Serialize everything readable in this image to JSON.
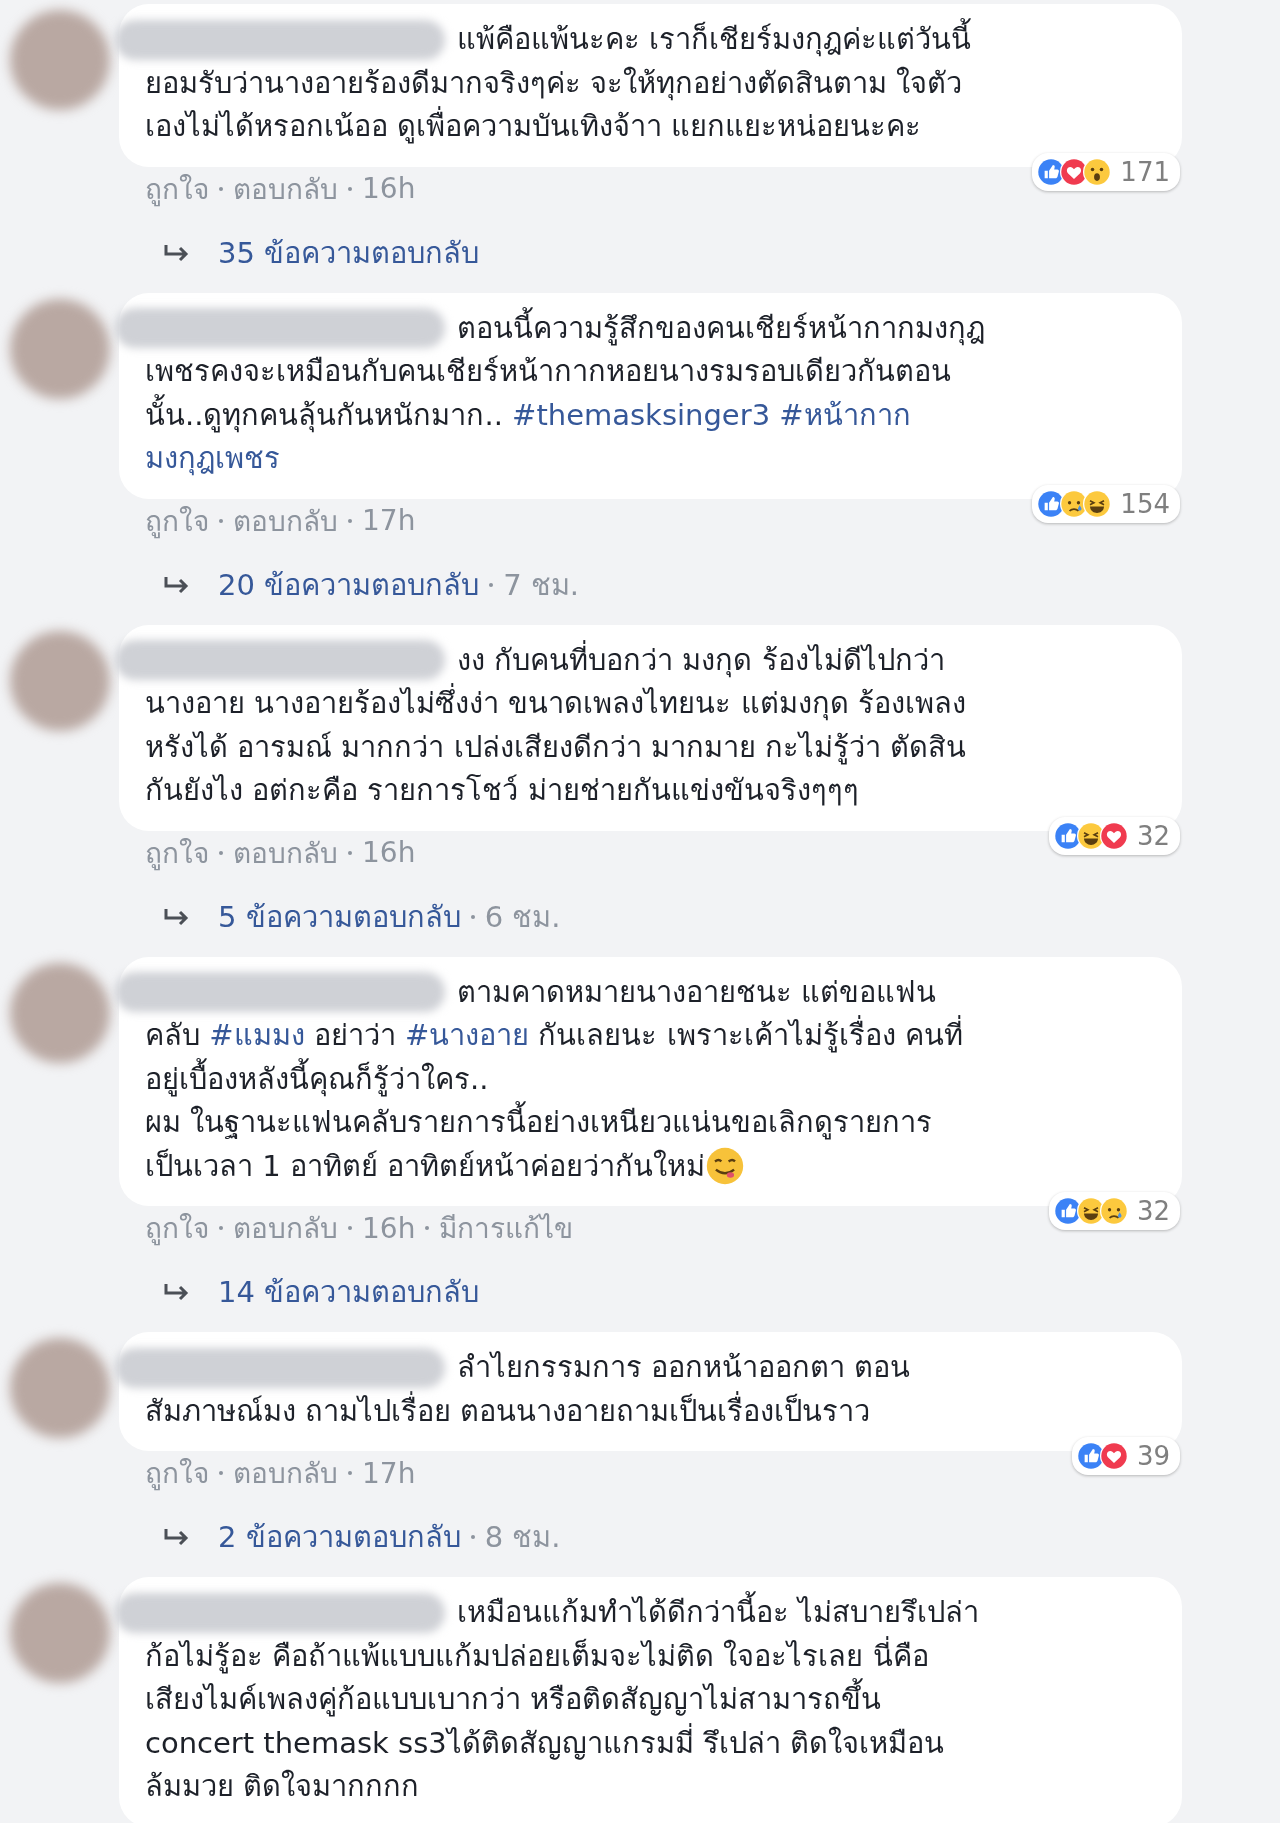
{
  "comments": [
    {
      "lines": [
        [
          {
            "kind": "text",
            "text": "แพ้คือแพ้นะคะ เราก็เชียร์มงกุฎค่ะแต่วันนี้"
          }
        ],
        [
          {
            "kind": "text",
            "text": "ยอมรับว่านางอายร้องดีมากจริงๆค่ะ จะให้ทุกอย่างตัดสินตาม ใจตัว"
          }
        ],
        [
          {
            "kind": "text",
            "text": "เองไม่ได้หรอกเน้ออ ดูเพื่อความบันเทิงจ้าา แยกแยะหน่อยนะคะ"
          }
        ]
      ],
      "reactions": [
        {
          "kind": "like"
        },
        {
          "kind": "love"
        },
        {
          "kind": "wow"
        }
      ],
      "reaction_count": "171",
      "like_label": "ถูกใจ",
      "reply_label": "ตอบกลับ",
      "time": "16h",
      "replies": {
        "label": "35 ข้อความตอบกลับ"
      }
    },
    {
      "lines": [
        [
          {
            "kind": "text",
            "text": "ตอนนี้ความรู้สึกของคนเชียร์หน้ากากมงกุฎ"
          }
        ],
        [
          {
            "kind": "text",
            "text": "เพชรคงจะเหมือนกับคนเชียร์หน้ากากหอยนางรมรอบเดียวกันตอน"
          }
        ],
        [
          {
            "kind": "text",
            "text": "นั้น..ดูทุกคนลุ้นกันหนักมาก.. "
          },
          {
            "kind": "hashtag",
            "text": "#themasksinger3 "
          },
          {
            "kind": "hashtag",
            "text": "#หน้ากาก"
          }
        ],
        [
          {
            "kind": "hashtag",
            "text": "มงกุฎเพชร"
          }
        ]
      ],
      "reactions": [
        {
          "kind": "like"
        },
        {
          "kind": "sad"
        },
        {
          "kind": "haha"
        }
      ],
      "reaction_count": "154",
      "like_label": "ถูกใจ",
      "reply_label": "ตอบกลับ",
      "time": "17h",
      "replies": {
        "label": "20 ข้อความตอบกลับ",
        "time": "7 ชม."
      }
    },
    {
      "lines": [
        [
          {
            "kind": "text",
            "text": "งง กับคนที่บอกว่า มงกุด ร้องไม่ดีไปกว่า"
          }
        ],
        [
          {
            "kind": "text",
            "text": "นางอาย นางอายร้องไม่ซึ่งง่า ขนาดเพลงไทยนะ แต่มงกุด ร้องเพลง"
          }
        ],
        [
          {
            "kind": "text",
            "text": "หรังได้ อารมณ์ มากกว่า เปล่งเสียงดีกว่า มากมาย กะไม่รู้ว่า ตัดสิน"
          }
        ],
        [
          {
            "kind": "text",
            "text": "กันยังไง อต่กะคือ รายการโชว์ ม่ายช่ายกันแข่งขันจริงๆๆๆ"
          }
        ]
      ],
      "reactions": [
        {
          "kind": "like"
        },
        {
          "kind": "haha"
        },
        {
          "kind": "love"
        }
      ],
      "reaction_count": "32",
      "like_label": "ถูกใจ",
      "reply_label": "ตอบกลับ",
      "time": "16h",
      "replies": {
        "label": "5 ข้อความตอบกลับ",
        "time": "6 ชม."
      }
    },
    {
      "lines": [
        [
          {
            "kind": "text",
            "text": "ตามคาดหมายนางอายชนะ แต่ขอแฟน"
          }
        ],
        [
          {
            "kind": "text",
            "text": "คลับ "
          },
          {
            "kind": "hashtag",
            "text": "#แมมง"
          },
          {
            "kind": "text",
            "text": " อย่าว่า "
          },
          {
            "kind": "hashtag",
            "text": "#นางอาย"
          },
          {
            "kind": "text",
            "text": " กันเลยนะ เพราะเค้าไม่รู้เรื่อง คนที่"
          }
        ],
        [
          {
            "kind": "text",
            "text": "อยู่เบื้องหลังนี้คุณก็รู้ว่าใคร.."
          }
        ],
        [
          {
            "kind": "text",
            "text": "ผม ในฐานะแฟนคลับรายการนี้อย่างเหนียวแน่นขอเลิกดูรายการ"
          }
        ],
        [
          {
            "kind": "text",
            "text": "เป็นเวลา 1 อาทิตย์ อาทิตย์หน้าค่อยว่ากันใหม่"
          },
          {
            "kind": "emoji"
          }
        ]
      ],
      "reactions": [
        {
          "kind": "like"
        },
        {
          "kind": "haha"
        },
        {
          "kind": "sad"
        }
      ],
      "reaction_count": "32",
      "like_label": "ถูกใจ",
      "reply_label": "ตอบกลับ",
      "time": "16h",
      "edited_label": "มีการแก้ไข",
      "replies": {
        "label": "14 ข้อความตอบกลับ"
      }
    },
    {
      "lines": [
        [
          {
            "kind": "text",
            "text": "ลำไยกรรมการ ออกหน้าออกตา ตอน"
          }
        ],
        [
          {
            "kind": "text",
            "text": "สัมภาษณ์มง ถามไปเรื่อย ตอนนางอายถามเป็นเรื่องเป็นราว"
          }
        ]
      ],
      "reactions": [
        {
          "kind": "like"
        },
        {
          "kind": "love"
        }
      ],
      "reaction_count": "39",
      "like_label": "ถูกใจ",
      "reply_label": "ตอบกลับ",
      "time": "17h",
      "replies": {
        "label": "2 ข้อความตอบกลับ",
        "time": "8 ชม."
      }
    },
    {
      "lines": [
        [
          {
            "kind": "text",
            "text": "เหมือนแก้มทำได้ดีกว่านี้อะ ไม่สบายรึเปล่า"
          }
        ],
        [
          {
            "kind": "text",
            "text": "ก้อไม่รู้อะ คือถ้าแพ้แบบแก้มปล่อยเต็มจะไม่ติด ใจอะไรเลย นี่คือ"
          }
        ],
        [
          {
            "kind": "text",
            "text": "เสียงไมค์เพลงคู่ก้อแบบเบากว่า หรือติดสัญญาไม่สามารถขึ้น"
          }
        ],
        [
          {
            "kind": "text",
            "text": "concert themask ss3ได้ติดสัญญาแกรมมี่ รึเปล่า ติดใจเหมือน"
          }
        ],
        [
          {
            "kind": "text",
            "text": "ล้มมวย ติดใจมากกกก"
          }
        ]
      ]
    }
  ]
}
